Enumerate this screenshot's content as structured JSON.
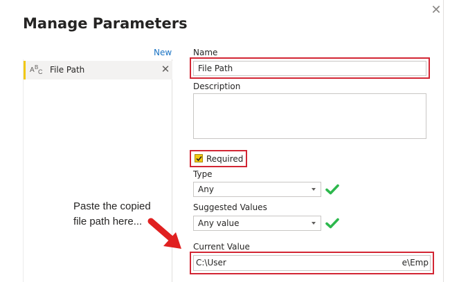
{
  "dialog": {
    "title": "Manage Parameters",
    "close_glyph": "✕"
  },
  "list": {
    "new_label": "New",
    "items": [
      {
        "label": "File Path",
        "icon": "text-type-icon",
        "remove_glyph": "✕",
        "icon_text": {
          "a": "A",
          "b": "B",
          "c": "C"
        }
      }
    ]
  },
  "form": {
    "name_label": "Name",
    "name_value": "File Path",
    "description_label": "Description",
    "description_value": "",
    "required_label": "Required",
    "required_checked": true,
    "type_label": "Type",
    "type_value": "Any",
    "suggested_label": "Suggested Values",
    "suggested_value": "Any value",
    "current_value_label": "Current Value",
    "current_value_start": "C:\\User",
    "current_value_end": "e\\Emp"
  },
  "annotation": {
    "line1": "Paste the copied",
    "line2": "file path here..."
  },
  "colors": {
    "highlight": "#d22533",
    "check_green": "#2db84d",
    "accent_yellow": "#f2c811",
    "link_blue": "#1a73c4"
  }
}
